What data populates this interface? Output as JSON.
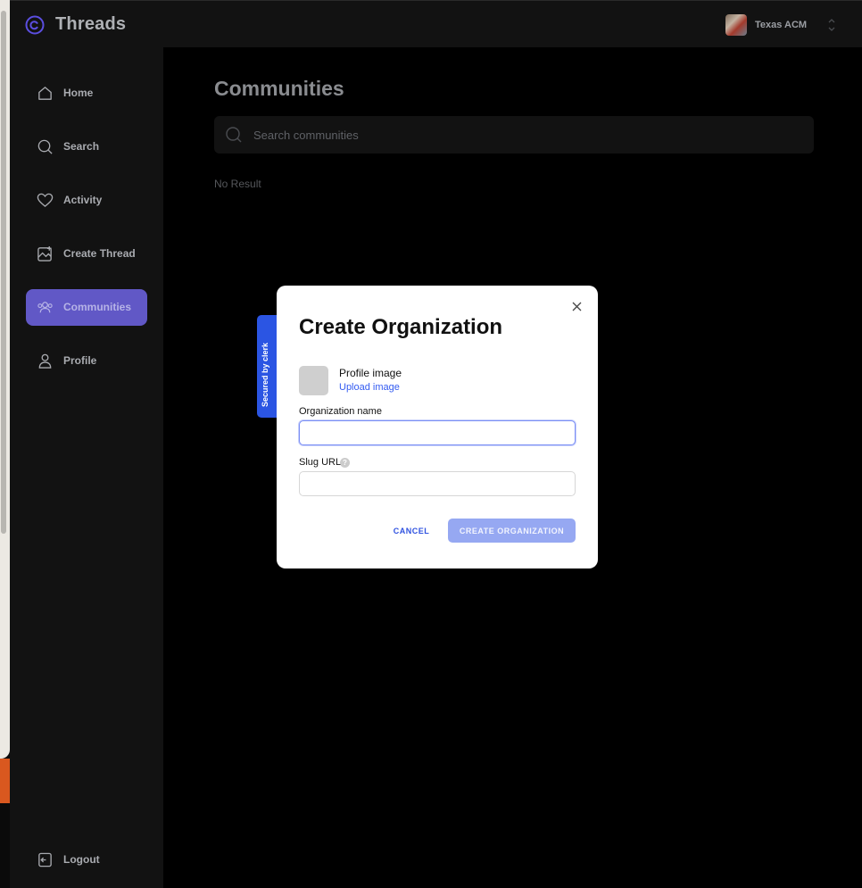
{
  "app": {
    "title": "Threads"
  },
  "organization": {
    "name": "Texas ACM"
  },
  "sidebar": {
    "items": [
      {
        "label": "Home",
        "icon": "home-icon"
      },
      {
        "label": "Search",
        "icon": "search-icon"
      },
      {
        "label": "Activity",
        "icon": "heart-icon"
      },
      {
        "label": "Create Thread",
        "icon": "create-thread-icon"
      },
      {
        "label": "Communities",
        "icon": "communities-icon",
        "active": true
      },
      {
        "label": "Profile",
        "icon": "profile-icon"
      }
    ],
    "logout_label": "Logout"
  },
  "main": {
    "title": "Communities",
    "search_placeholder": "Search communities",
    "empty_message": "No Result"
  },
  "badge": {
    "text": "Secured by clerk"
  },
  "modal": {
    "title": "Create Organization",
    "profile_image_label": "Profile image",
    "upload_label": "Upload image",
    "org_name_label": "Organization name",
    "org_name_value": "",
    "slug_label": "Slug URL",
    "slug_value": "",
    "cancel_label": "CANCEL",
    "create_label": "CREATE ORGANIZATION"
  },
  "colors": {
    "accent": "#6158c6",
    "primary_button": "#96a8f2",
    "link": "#335bf1",
    "badge": "#2b55e3"
  }
}
